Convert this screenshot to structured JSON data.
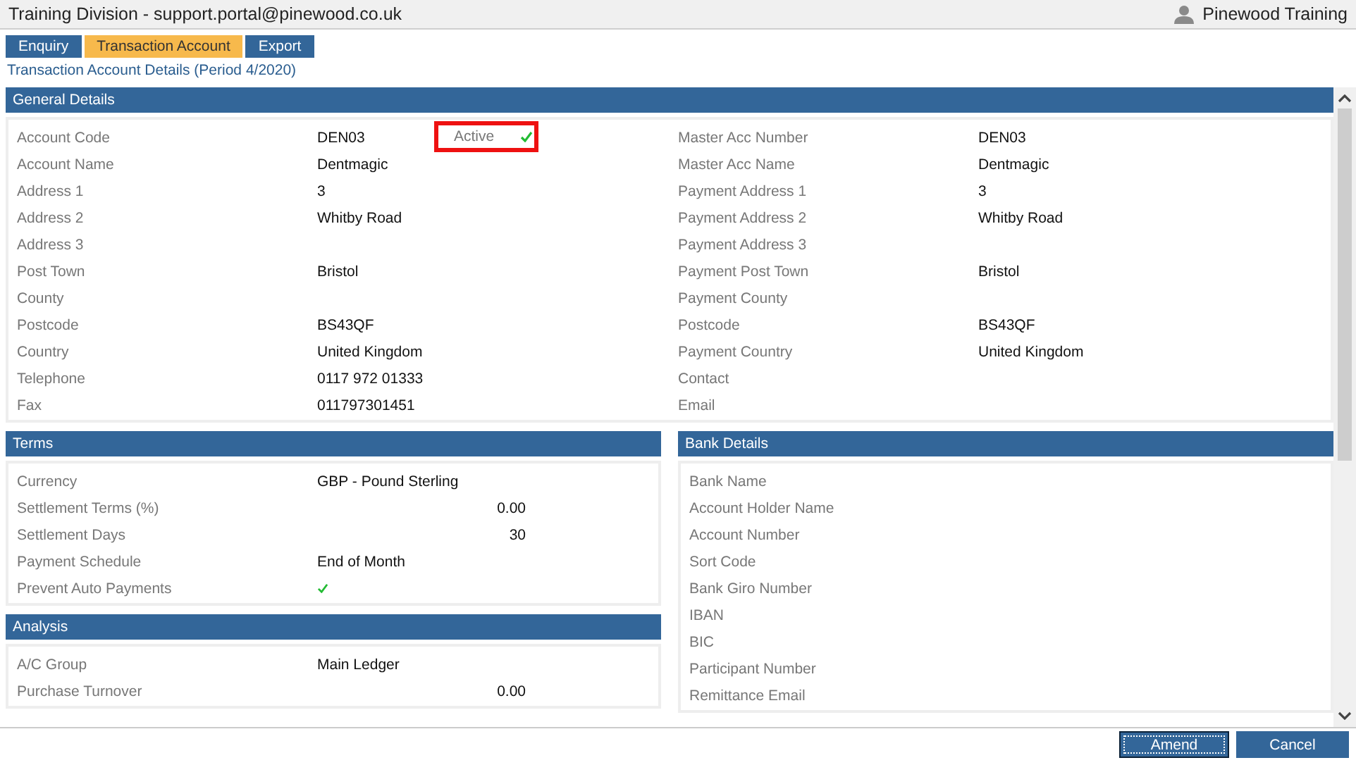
{
  "window": {
    "title": "Training Division - support.portal@pinewood.co.uk",
    "user": "Pinewood Training"
  },
  "tabs": [
    {
      "label": "Enquiry",
      "selected": false
    },
    {
      "label": "Transaction Account",
      "selected": true
    },
    {
      "label": "Export",
      "selected": false
    }
  ],
  "subtitle": "Transaction Account Details (Period 4/2020)",
  "general": {
    "title": "General Details",
    "active": {
      "label": "Active",
      "checked": true,
      "highlighted": true
    },
    "left": [
      {
        "label": "Account Code",
        "value": "DEN03"
      },
      {
        "label": "Account Name",
        "value": "Dentmagic"
      },
      {
        "label": "Address 1",
        "value": "3"
      },
      {
        "label": "Address 2",
        "value": "Whitby Road"
      },
      {
        "label": "Address 3"
      },
      {
        "label": "Post Town",
        "value": "Bristol"
      },
      {
        "label": "County"
      },
      {
        "label": "Postcode",
        "value": "BS43QF"
      },
      {
        "label": "Country",
        "value": "United Kingdom"
      },
      {
        "label": "Telephone",
        "value": "0117 972 01333"
      },
      {
        "label": "Fax",
        "value": "011797301451"
      }
    ],
    "right": [
      {
        "label": "Master Acc Number",
        "value": "DEN03"
      },
      {
        "label": "Master Acc Name",
        "value": "Dentmagic"
      },
      {
        "label": "Payment Address 1",
        "value": "3"
      },
      {
        "label": "Payment Address 2",
        "value": "Whitby Road"
      },
      {
        "label": "Payment Address 3"
      },
      {
        "label": "Payment Post Town",
        "value": "Bristol"
      },
      {
        "label": "Payment County"
      },
      {
        "label": "Postcode",
        "value": "BS43QF"
      },
      {
        "label": "Payment Country",
        "value": "United Kingdom"
      },
      {
        "label": "Contact"
      },
      {
        "label": "Email"
      }
    ]
  },
  "terms": {
    "title": "Terms",
    "rows": [
      {
        "kind": "text",
        "label": "Currency",
        "value": "GBP - Pound Sterling"
      },
      {
        "kind": "number",
        "label": "Settlement Terms (%)",
        "value": "0.00"
      },
      {
        "kind": "number",
        "label": "Settlement Days",
        "value": "30"
      },
      {
        "kind": "text",
        "label": "Payment Schedule",
        "value": "End of Month"
      },
      {
        "kind": "check",
        "label": "Prevent Auto Payments",
        "checked": true
      }
    ]
  },
  "analysis": {
    "title": "Analysis",
    "rows": [
      {
        "kind": "text",
        "label": "A/C Group",
        "value": "Main Ledger"
      },
      {
        "kind": "number",
        "label": "Purchase Turnover",
        "value": "0.00"
      }
    ]
  },
  "bank": {
    "title": "Bank Details",
    "rows": [
      {
        "label": "Bank Name"
      },
      {
        "label": "Account Holder Name"
      },
      {
        "label": "Account Number"
      },
      {
        "label": "Sort Code"
      },
      {
        "label": "Bank Giro Number"
      },
      {
        "label": "IBAN"
      },
      {
        "label": "BIC"
      },
      {
        "label": "Participant Number"
      },
      {
        "label": "Remittance Email"
      }
    ]
  },
  "buttons": [
    {
      "label": "Amend",
      "focused": true
    },
    {
      "label": "Cancel",
      "focused": false
    }
  ]
}
